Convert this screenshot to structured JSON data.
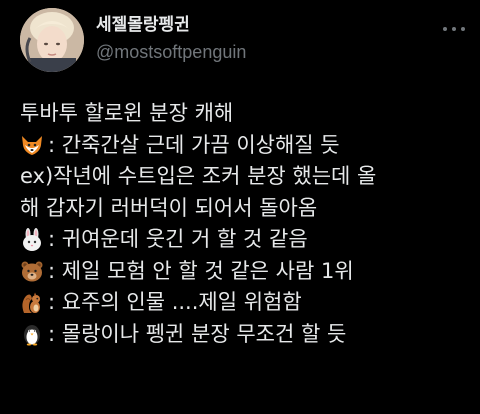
{
  "user": {
    "display_name": "세젤몰랑펭귄",
    "handle": "@mostsoftpenguin"
  },
  "tweet": {
    "lines": [
      {
        "emoji": "",
        "text": "투바투 할로윈 분장 캐해"
      },
      {
        "emoji": "fox-icon",
        "text": " : 간죽간살 근데 가끔 이상해질 듯"
      },
      {
        "emoji": "",
        "text": "ex)작년에 수트입은 조커 분장 했는데 올"
      },
      {
        "emoji": "",
        "text": "해 갑자기 러버덕이 되어서 돌아옴"
      },
      {
        "emoji": "rabbit-icon",
        "text": " : 귀여운데 웃긴 거 할 것 같음"
      },
      {
        "emoji": "bear-icon",
        "text": " : 제일 모험 안 할 것 같은 사람 1위"
      },
      {
        "emoji": "squirrel-icon",
        "text": " : 요주의 인물 ....제일 위험함"
      },
      {
        "emoji": "penguin-icon",
        "text": " : 몰랑이나 펭귄 분장 무조건 할 듯"
      }
    ]
  },
  "colors": {
    "background": "#000000",
    "text": "#e7e9ea",
    "secondary_text": "#71767b"
  }
}
